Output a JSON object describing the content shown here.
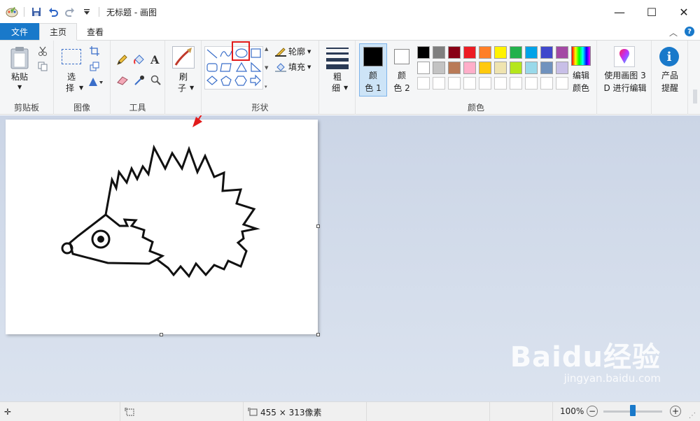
{
  "window": {
    "title": "无标题 - 画图",
    "controls": {
      "minimize": "—",
      "maximize": "☐",
      "close": "✕"
    }
  },
  "tabs": [
    {
      "label": "文件"
    },
    {
      "label": "主页"
    },
    {
      "label": "查看"
    }
  ],
  "ribbon": {
    "clipboard": {
      "group_label": "剪贴板",
      "paste_label": "粘贴"
    },
    "image": {
      "group_label": "图像",
      "select_label_1": "选",
      "select_label_2": "择"
    },
    "tools": {
      "group_label": "工具",
      "text_glyph": "A"
    },
    "brushes": {
      "label_1": "刷",
      "label_2": "子"
    },
    "shapes": {
      "group_label": "形状",
      "outline_label": "轮廓",
      "fill_label": "填充"
    },
    "size": {
      "label_1": "粗",
      "label_2": "细"
    },
    "colors": {
      "group_label": "颜色",
      "color1_label_1": "颜",
      "color1_label_2": "色 1",
      "color2_label_1": "颜",
      "color2_label_2": "色 2",
      "color1_value": "#000000",
      "color2_value": "#ffffff",
      "palette_row1": [
        "#000000",
        "#7f7f7f",
        "#880015",
        "#ed1c24",
        "#ff7f27",
        "#fff200",
        "#22b14c",
        "#00a2e8",
        "#3f48cc",
        "#a349a4"
      ],
      "palette_row2": [
        "#ffffff",
        "#c3c3c3",
        "#b97a57",
        "#ffaec9",
        "#ffc90e",
        "#efe4b0",
        "#b5e61d",
        "#99d9ea",
        "#7092be",
        "#c8bfe7"
      ],
      "edit_label_1": "编辑",
      "edit_label_2": "颜色"
    },
    "paint3d": {
      "label_1": "使用画图 3",
      "label_2": "D 进行编辑"
    },
    "product": {
      "label_1": "产品",
      "label_2": "提醒"
    }
  },
  "status": {
    "canvas_size": "455 × 313像素",
    "zoom": "100%",
    "zoom_fraction": 0.5
  },
  "watermark": {
    "main": "Baidu经验",
    "sub": "jingyan.baidu.com"
  },
  "colors": {
    "accent": "#1979ca",
    "highlight": "#e21b1b"
  }
}
